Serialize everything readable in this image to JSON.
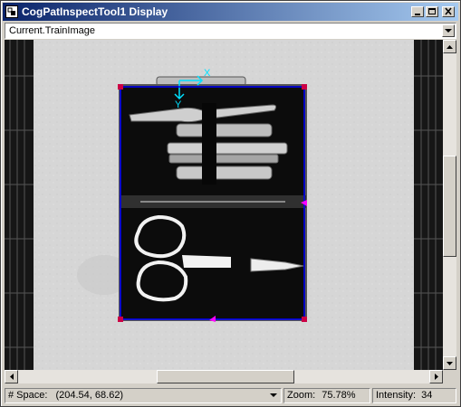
{
  "window": {
    "title": "CogPatInspectTool1 Display",
    "title_icon": "display-window-icon",
    "accent": "#0a246a"
  },
  "image_selector": {
    "selected": "Current.TrainImage"
  },
  "overlay": {
    "x_axis_label": "X",
    "y_axis_label": "Y",
    "axis_color": "#00e0ff",
    "region_color": "#0000ff",
    "handle_color": "#ff00ff"
  },
  "statusbar": {
    "space_label": "# Space:",
    "space_value": "(204.54, 68.62)",
    "zoom_label": "Zoom:",
    "zoom_value": "75.78%",
    "intensity_label": "Intensity:",
    "intensity_value": "34"
  }
}
